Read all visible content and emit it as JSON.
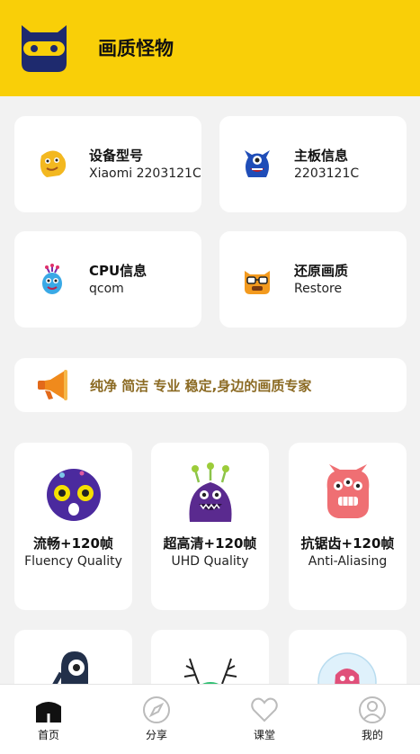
{
  "header": {
    "title": "画质怪物"
  },
  "info_cards": [
    {
      "label": "设备型号",
      "value": "Xiaomi 2203121C"
    },
    {
      "label": "主板信息",
      "value": "2203121C"
    },
    {
      "label": "CPU信息",
      "value": "qcom"
    },
    {
      "label": "还原画质",
      "value": "Restore"
    }
  ],
  "banner": {
    "text": "纯净 简洁 专业 稳定,身边的画质专家"
  },
  "modes": [
    {
      "title": "流畅+120帧",
      "subtitle": "Fluency Quality"
    },
    {
      "title": "超高清+120帧",
      "subtitle": "UHD Quality"
    },
    {
      "title": "抗锯齿+120帧",
      "subtitle": "Anti-Aliasing"
    }
  ],
  "tabbar": [
    {
      "label": "首页"
    },
    {
      "label": "分享"
    },
    {
      "label": "课堂"
    },
    {
      "label": "我的"
    }
  ],
  "colors": {
    "brand_yellow": "#f9cf08",
    "slogan": "#8b6a23",
    "background": "#f2f2f2"
  }
}
